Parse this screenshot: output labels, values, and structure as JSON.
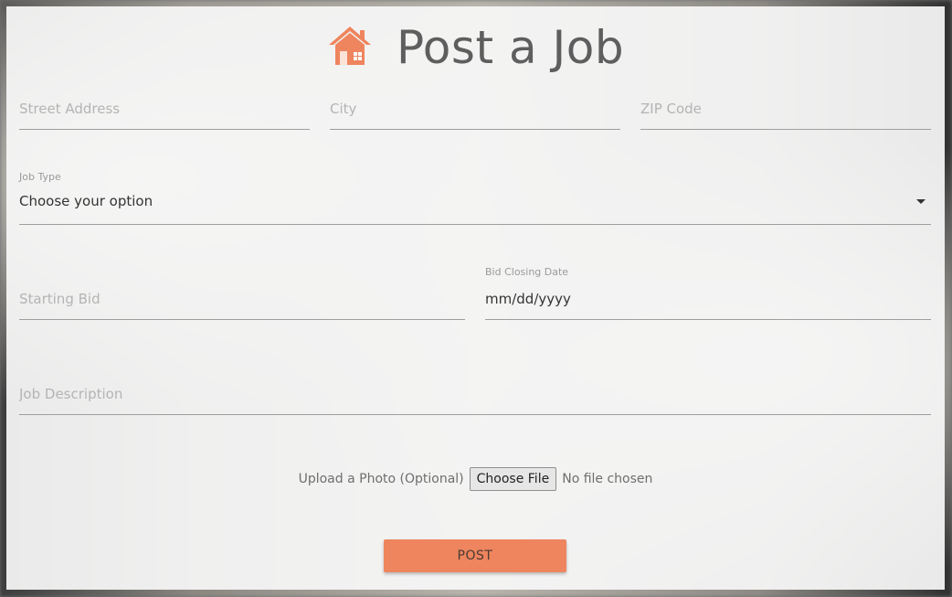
{
  "header": {
    "title": "Post a Job",
    "icon": "house-icon"
  },
  "colors": {
    "accent": "#ee855e",
    "title": "#5e5e5e"
  },
  "address": {
    "street_placeholder": "Street Address",
    "city_placeholder": "City",
    "zip_placeholder": "ZIP Code"
  },
  "job_type": {
    "label": "Job Type",
    "value": "Choose your option"
  },
  "bid": {
    "starting_placeholder": "Starting Bid",
    "closing_label": "Bid Closing Date",
    "closing_value": "mm/dd/yyyy"
  },
  "description": {
    "placeholder": "Job Description"
  },
  "upload": {
    "label": "Upload a Photo (Optional)",
    "button": "Choose File",
    "status": "No file chosen"
  },
  "submit": {
    "label": "POST"
  }
}
